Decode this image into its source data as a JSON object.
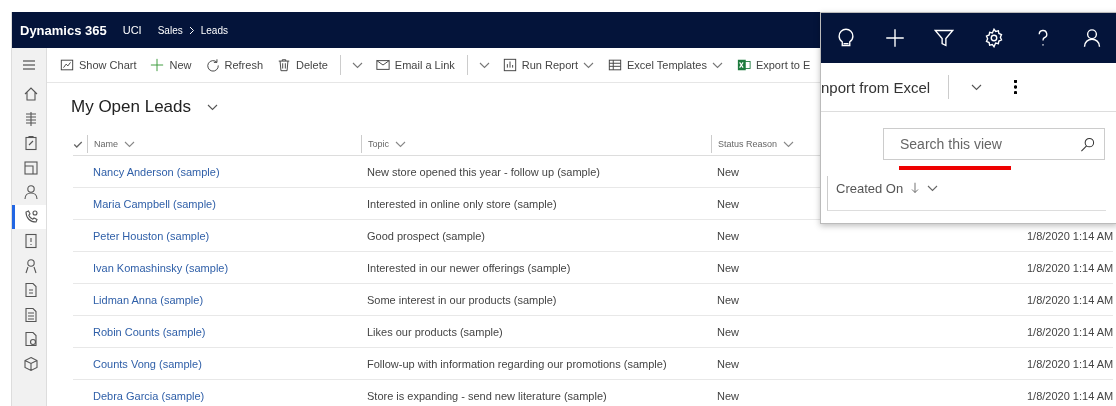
{
  "header": {
    "brand": "Dynamics 365",
    "app": "UCI",
    "breadcrumb": [
      "Sales",
      "Leads"
    ]
  },
  "toolbar": [
    {
      "label": "Show Chart",
      "kind": "plain"
    },
    {
      "label": "New",
      "kind": "plain"
    },
    {
      "label": "Refresh",
      "kind": "plain"
    },
    {
      "label": "Delete",
      "kind": "split"
    },
    {
      "label": "Email a Link",
      "kind": "split"
    },
    {
      "label": "Run Report",
      "kind": "menu"
    },
    {
      "label": "Excel Templates",
      "kind": "menu"
    },
    {
      "label": "Export to E",
      "kind": "plain"
    }
  ],
  "sidebar": {
    "items": [
      {
        "selected": false
      },
      {
        "selected": false
      },
      {
        "selected": false
      },
      {
        "selected": false
      },
      {
        "selected": false
      },
      {
        "selected": true
      },
      {
        "selected": false
      },
      {
        "selected": false
      },
      {
        "selected": false
      },
      {
        "selected": false
      },
      {
        "selected": false
      },
      {
        "selected": false
      }
    ]
  },
  "view_title": "My Open Leads",
  "table": {
    "columns": [
      "Name",
      "Topic",
      "Status Reason"
    ],
    "rows": [
      {
        "name": "Nancy Anderson (sample)",
        "topic": "New store opened this year - follow up (sample)",
        "status": "New"
      },
      {
        "name": "Maria Campbell (sample)",
        "topic": "Interested in online only store (sample)",
        "status": "New"
      },
      {
        "name": "Peter Houston (sample)",
        "topic": "Good prospect (sample)",
        "status": "New",
        "created_on": "1/8/2020 1:14 AM"
      },
      {
        "name": "Ivan Komashinsky (sample)",
        "topic": "Interested in our newer offerings (sample)",
        "status": "New",
        "created_on": "1/8/2020 1:14 AM"
      },
      {
        "name": "Lidman Anna (sample)",
        "topic": "Some interest in our products (sample)",
        "status": "New",
        "created_on": "1/8/2020 1:14 AM"
      },
      {
        "name": "Robin Counts (sample)",
        "topic": "Likes our products (sample)",
        "status": "New",
        "created_on": "1/8/2020 1:14 AM"
      },
      {
        "name": "Counts Vong (sample)",
        "topic": "Follow-up with information regarding our promotions (sample)",
        "status": "New",
        "created_on": "1/8/2020 1:14 AM"
      },
      {
        "name": "Debra Garcia (sample)",
        "topic": "Store is expanding - send new literature (sample)",
        "status": "New",
        "created_on": "1/8/2020 1:14 AM"
      }
    ]
  },
  "zoom_panel": {
    "command": "nport from Excel",
    "search": {
      "placeholder": "Search this view"
    },
    "column": "Created On"
  }
}
